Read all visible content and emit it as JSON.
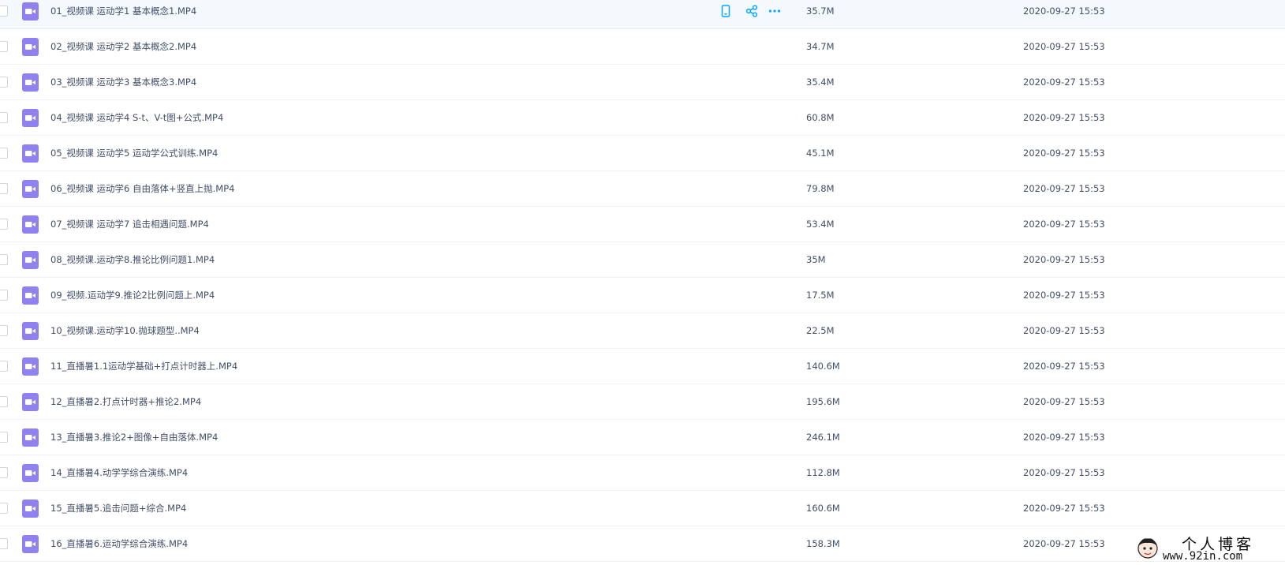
{
  "files": [
    {
      "name": "01_视频课 运动学1 基本概念1.MP4",
      "size": "35.7M",
      "date": "2020-09-27 15:53",
      "type_icon": "video-file-icon"
    },
    {
      "name": "02_视频课 运动学2 基本概念2.MP4",
      "size": "34.7M",
      "date": "2020-09-27 15:53",
      "type_icon": "video-file-icon"
    },
    {
      "name": "03_视频课 运动学3 基本概念3.MP4",
      "size": "35.4M",
      "date": "2020-09-27 15:53",
      "type_icon": "video-file-icon"
    },
    {
      "name": "04_视频课 运动学4 S-t、V-t图+公式.MP4",
      "size": "60.8M",
      "date": "2020-09-27 15:53",
      "type_icon": "video-file-icon"
    },
    {
      "name": "05_视频课 运动学5 运动学公式训练.MP4",
      "size": "45.1M",
      "date": "2020-09-27 15:53",
      "type_icon": "video-file-icon"
    },
    {
      "name": "06_视频课 运动学6 自由落体+竖直上抛.MP4",
      "size": "79.8M",
      "date": "2020-09-27 15:53",
      "type_icon": "video-file-icon"
    },
    {
      "name": "07_视频课 运动学7 追击相遇问题.MP4",
      "size": "53.4M",
      "date": "2020-09-27 15:53",
      "type_icon": "video-file-icon"
    },
    {
      "name": "08_视频课.运动学8.推论比例问题1.MP4",
      "size": "35M",
      "date": "2020-09-27 15:53",
      "type_icon": "video-file-icon"
    },
    {
      "name": "09_视频.运动学9.推论2比例问题上.MP4",
      "size": "17.5M",
      "date": "2020-09-27 15:53",
      "type_icon": "video-file-icon"
    },
    {
      "name": "10_视频课.运动学10.抛球题型..MP4",
      "size": "22.5M",
      "date": "2020-09-27 15:53",
      "type_icon": "video-file-icon"
    },
    {
      "name": "11_直播暑1.1运动学基础+打点计时器上.MP4",
      "size": "140.6M",
      "date": "2020-09-27 15:53",
      "type_icon": "video-file-icon"
    },
    {
      "name": "12_直播暑2.打点计时器+推论2.MP4",
      "size": "195.6M",
      "date": "2020-09-27 15:53",
      "type_icon": "video-file-icon"
    },
    {
      "name": "13_直播暑3.推论2+图像+自由落体.MP4",
      "size": "246.1M",
      "date": "2020-09-27 15:53",
      "type_icon": "video-file-icon"
    },
    {
      "name": "14_直播暑4.动学学综合演练.MP4",
      "size": "112.8M",
      "date": "2020-09-27 15:53",
      "type_icon": "video-file-icon"
    },
    {
      "name": "15_直播暑5.追击问题+综合.MP4",
      "size": "160.6M",
      "date": "2020-09-27 15:53",
      "type_icon": "video-file-icon"
    },
    {
      "name": "16_直播暑6.运动学综合演练.MP4",
      "size": "158.3M",
      "date": "2020-09-27 15:53",
      "type_icon": "video-file-icon"
    }
  ],
  "hover_row_index": 0,
  "hover_actions": [
    {
      "name": "phone-icon"
    },
    {
      "name": "share-icon"
    },
    {
      "name": "more-icon"
    }
  ],
  "colors": {
    "accent": "#06a7ff",
    "video_icon": "#8f82f0",
    "text": "#424e67",
    "hover_bg": "#f4f9fe"
  },
  "watermark": {
    "title": "个人博客",
    "url": "www.92in.com"
  }
}
